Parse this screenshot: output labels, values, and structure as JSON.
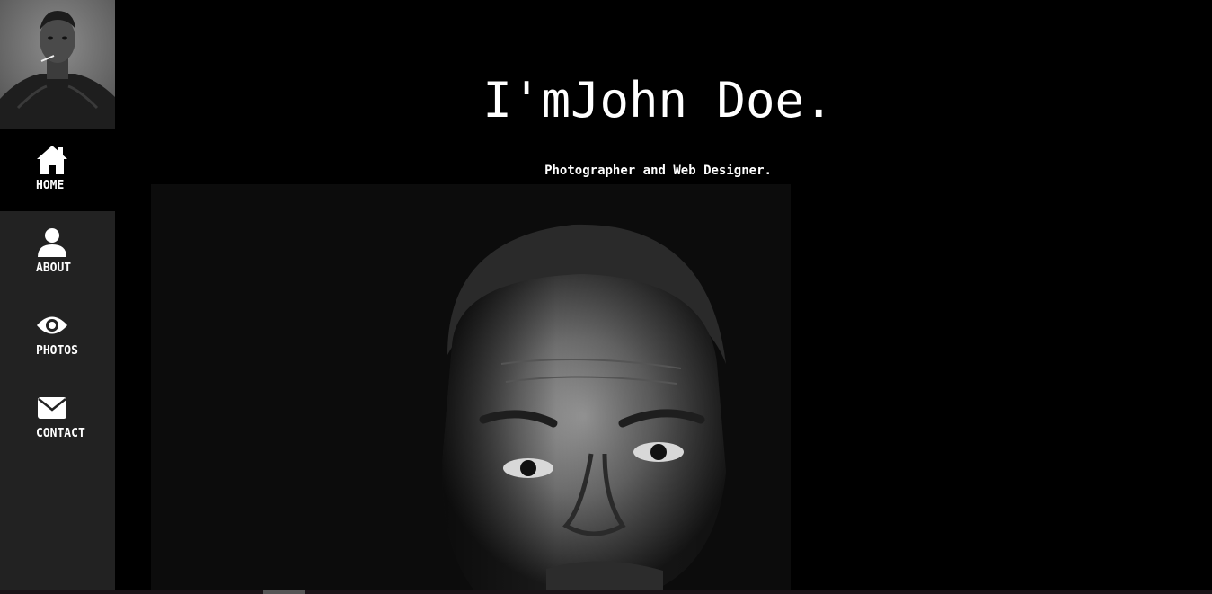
{
  "hero": {
    "title": "I'mJohn Doe.",
    "subtitle": "Photographer and Web Designer."
  },
  "sidebar": {
    "avatar_icon": "portrait-photo",
    "items": [
      {
        "label": "HOME",
        "icon": "home-icon",
        "active": true
      },
      {
        "label": "ABOUT",
        "icon": "user-icon",
        "active": false
      },
      {
        "label": "PHOTOS",
        "icon": "eye-icon",
        "active": false
      },
      {
        "label": "CONTACT",
        "icon": "envelope-icon",
        "active": false
      }
    ]
  },
  "colors": {
    "sidebar_bg": "#222222",
    "active_bg": "#000000",
    "page_bg": "#000000",
    "text": "#ffffff"
  }
}
